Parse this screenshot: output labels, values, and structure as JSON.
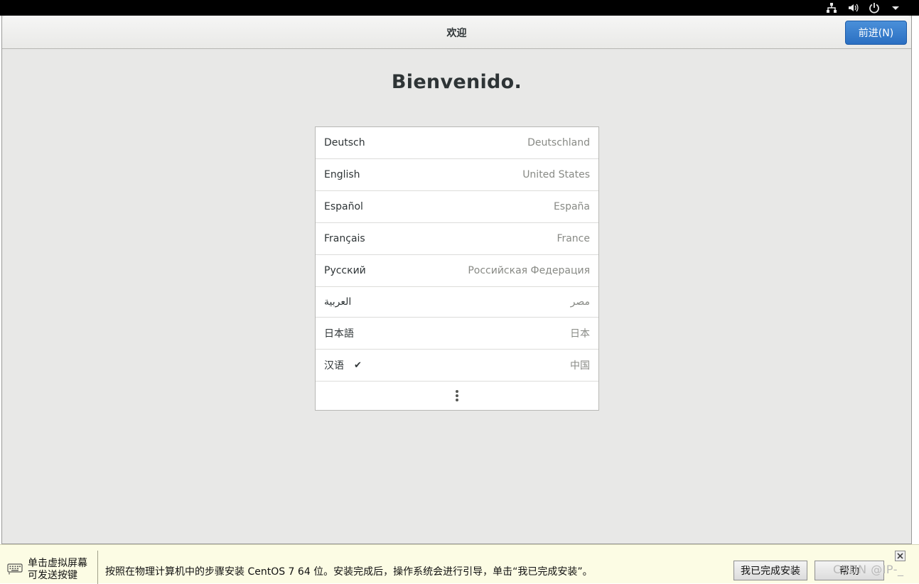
{
  "system_bar": {
    "icons": [
      "network-icon",
      "volume-icon",
      "power-icon",
      "chevron-down-icon"
    ]
  },
  "header": {
    "title": "欢迎",
    "next_button": "前进(N)"
  },
  "welcome_text": "Bienvenido.",
  "languages": [
    {
      "language": "Deutsch",
      "region": "Deutschland",
      "selected": false
    },
    {
      "language": "English",
      "region": "United States",
      "selected": false
    },
    {
      "language": "Español",
      "region": "España",
      "selected": false
    },
    {
      "language": "Français",
      "region": "France",
      "selected": false
    },
    {
      "language": "Русский",
      "region": "Российская Федерация",
      "selected": false
    },
    {
      "language": "العربية",
      "region": "مصر",
      "selected": false
    },
    {
      "language": "日本語",
      "region": "日本",
      "selected": false
    },
    {
      "language": "汉语",
      "region": "中国",
      "selected": true
    }
  ],
  "selected_mark": "✔",
  "hint_bar": {
    "left_line1": "单击虚拟屏幕",
    "left_line2": "可发送按键",
    "message": "按照在物理计算机中的步骤安装 CentOS 7 64 位。安装完成后，操作系统会进行引导，单击“我已完成安装”。",
    "done_button": "我已完成安装",
    "help_button": "帮助"
  },
  "watermark": "CSDN @IP-_"
}
